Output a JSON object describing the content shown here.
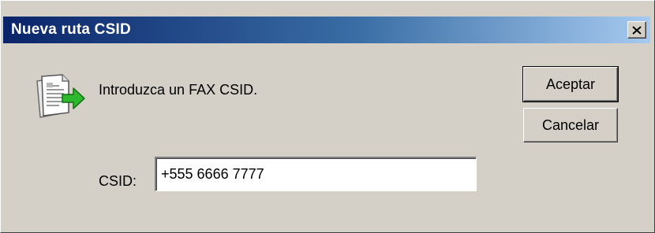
{
  "window": {
    "title": "Nueva ruta CSID",
    "close_symbol": "×"
  },
  "dialog": {
    "icon": "fax-route-icon",
    "prompt": "Introduzca un FAX CSID.",
    "field_label": "CSID:",
    "field_value": "+555 6666 7777"
  },
  "buttons": {
    "ok": "Aceptar",
    "cancel": "Cancelar"
  },
  "colors": {
    "face": "#d4d0c8",
    "title_start": "#0a246a",
    "title_end": "#a6caf0",
    "arrow_green": "#2eb82e"
  }
}
